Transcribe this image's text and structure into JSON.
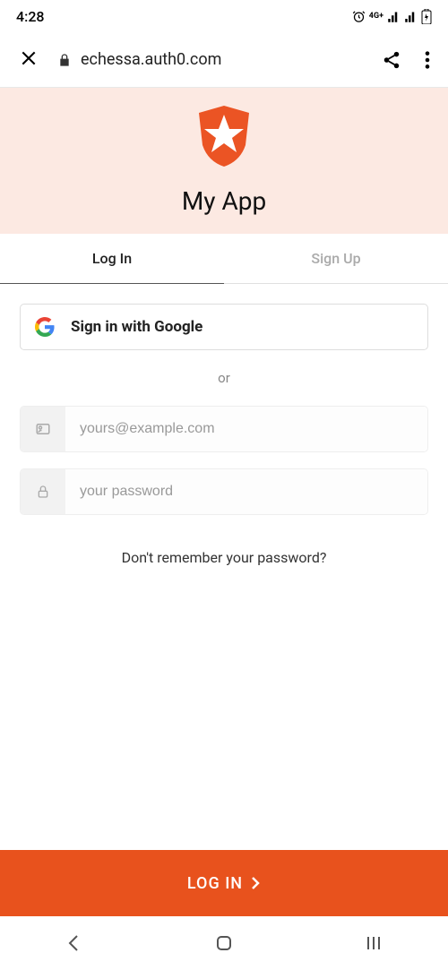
{
  "status": {
    "time": "4:28",
    "network": "4G+"
  },
  "browser": {
    "url": "echessa.auth0.com"
  },
  "header": {
    "app_title": "My App"
  },
  "tabs": {
    "login": "Log In",
    "signup": "Sign Up"
  },
  "social": {
    "google_label": "Sign in with Google"
  },
  "divider": "or",
  "inputs": {
    "email_placeholder": "yours@example.com",
    "password_placeholder": "your password"
  },
  "forgot": "Don't remember your password?",
  "submit": "LOG IN"
}
